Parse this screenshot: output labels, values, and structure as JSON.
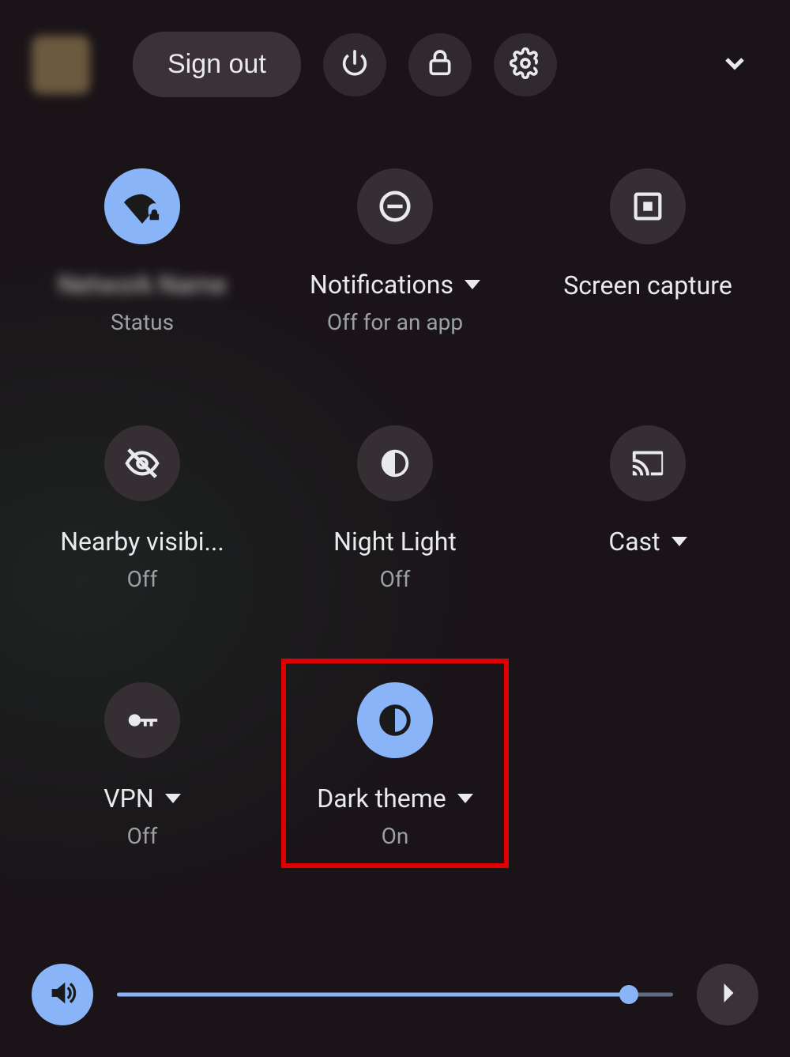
{
  "header": {
    "signout_label": "Sign out"
  },
  "tiles": {
    "wifi": {
      "label": "",
      "sub": "",
      "active": true
    },
    "notifications": {
      "label": "Notifications",
      "sub": "Off for an app",
      "has_caret": true
    },
    "screen_capture": {
      "label": "Screen capture",
      "sub": ""
    },
    "nearby": {
      "label": "Nearby visibi...",
      "sub": "Off"
    },
    "night_light": {
      "label": "Night Light",
      "sub": "Off"
    },
    "cast": {
      "label": "Cast",
      "sub": "",
      "has_caret": true
    },
    "vpn": {
      "label": "VPN",
      "sub": "Off",
      "has_caret": true
    },
    "dark_theme": {
      "label": "Dark theme",
      "sub": "On",
      "active": true,
      "has_caret": true,
      "highlighted": true
    }
  },
  "volume": {
    "percent": 92
  },
  "colors": {
    "accent": "#89b4f8",
    "highlight": "#e10000"
  }
}
